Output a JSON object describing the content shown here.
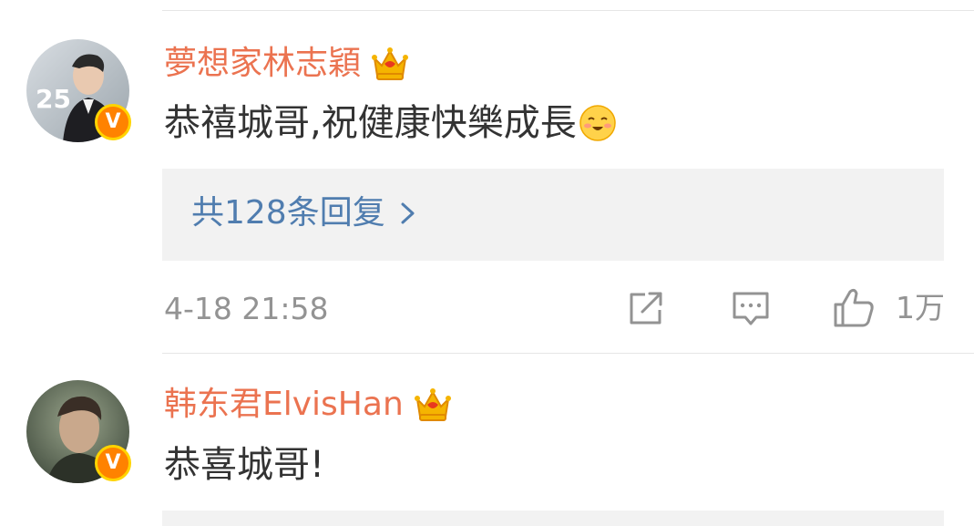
{
  "comments": [
    {
      "username": "夢想家林志穎",
      "text": "恭禧城哥,祝健康快樂成長",
      "emoji": "smiling-blush-emoji",
      "replies_label": "共128条回复",
      "time": "4-18 21:58",
      "like_count": "1万",
      "avatar_text": "25",
      "badge_text": "V"
    },
    {
      "username": "韩东君ElvisHan",
      "text": "恭喜城哥!",
      "badge_text": "V"
    }
  ],
  "colors": {
    "username": "#eb7350",
    "link": "#507daf",
    "text": "#333333",
    "meta": "#939393",
    "badge": "#ff8200",
    "reply_bg": "#f2f2f2"
  },
  "icons": [
    "crown-icon",
    "chevron-right-icon",
    "share-icon",
    "comment-icon",
    "like-icon",
    "verified-v-icon"
  ]
}
